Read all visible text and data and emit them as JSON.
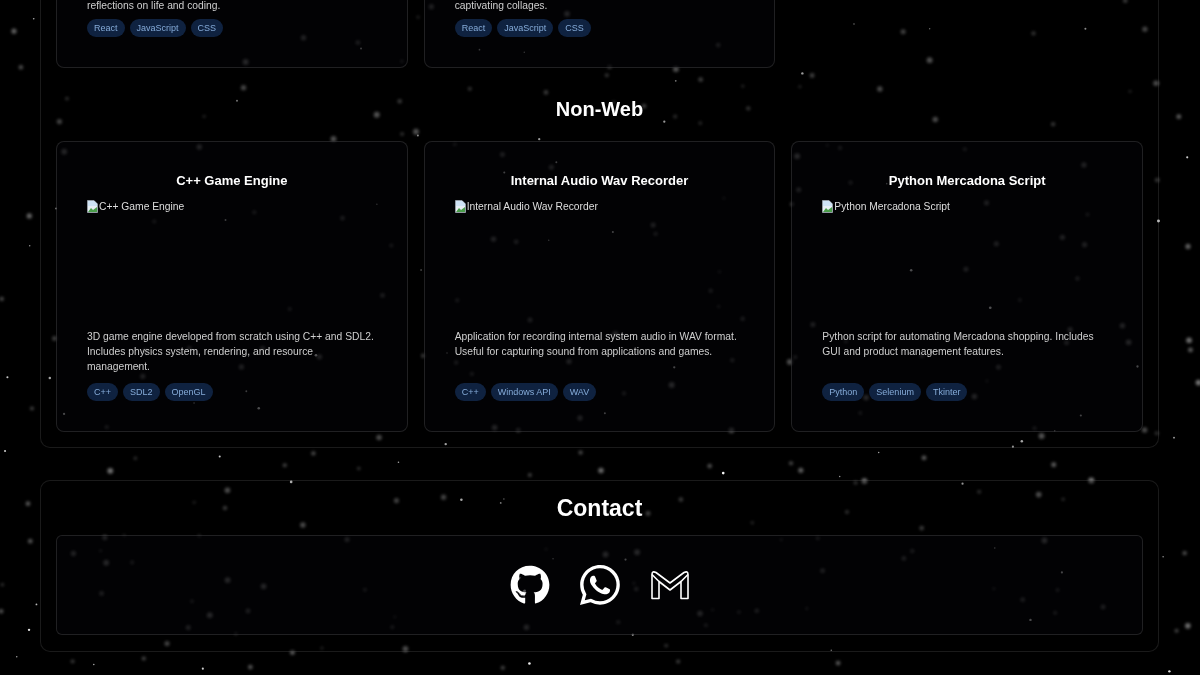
{
  "projects": {
    "top_cards": [
      {
        "description": "reflections on life and coding.",
        "tags": [
          "React",
          "JavaScript",
          "CSS"
        ]
      },
      {
        "description": "captivating collages.",
        "tags": [
          "React",
          "JavaScript",
          "CSS"
        ]
      }
    ],
    "non_web": {
      "heading": "Non-Web",
      "cards": [
        {
          "title": "C++ Game Engine",
          "image_alt": "C++ Game Engine",
          "description": "3D game engine developed from scratch using C++ and SDL2. Includes physics system, rendering, and resource management.",
          "tags": [
            "C++",
            "SDL2",
            "OpenGL"
          ]
        },
        {
          "title": "Internal Audio Wav Recorder",
          "image_alt": "Internal Audio Wav Recorder",
          "description": "Application for recording internal system audio in WAV format. Useful for capturing sound from applications and games.",
          "tags": [
            "C++",
            "Windows API",
            "WAV"
          ]
        },
        {
          "title": "Python Mercadona Script",
          "image_alt": "Python Mercadona Script",
          "description": "Python script for automating Mercadona shopping. Includes GUI and product management features.",
          "tags": [
            "Python",
            "Selenium",
            "Tkinter"
          ]
        }
      ]
    }
  },
  "contact": {
    "title": "Contact"
  }
}
